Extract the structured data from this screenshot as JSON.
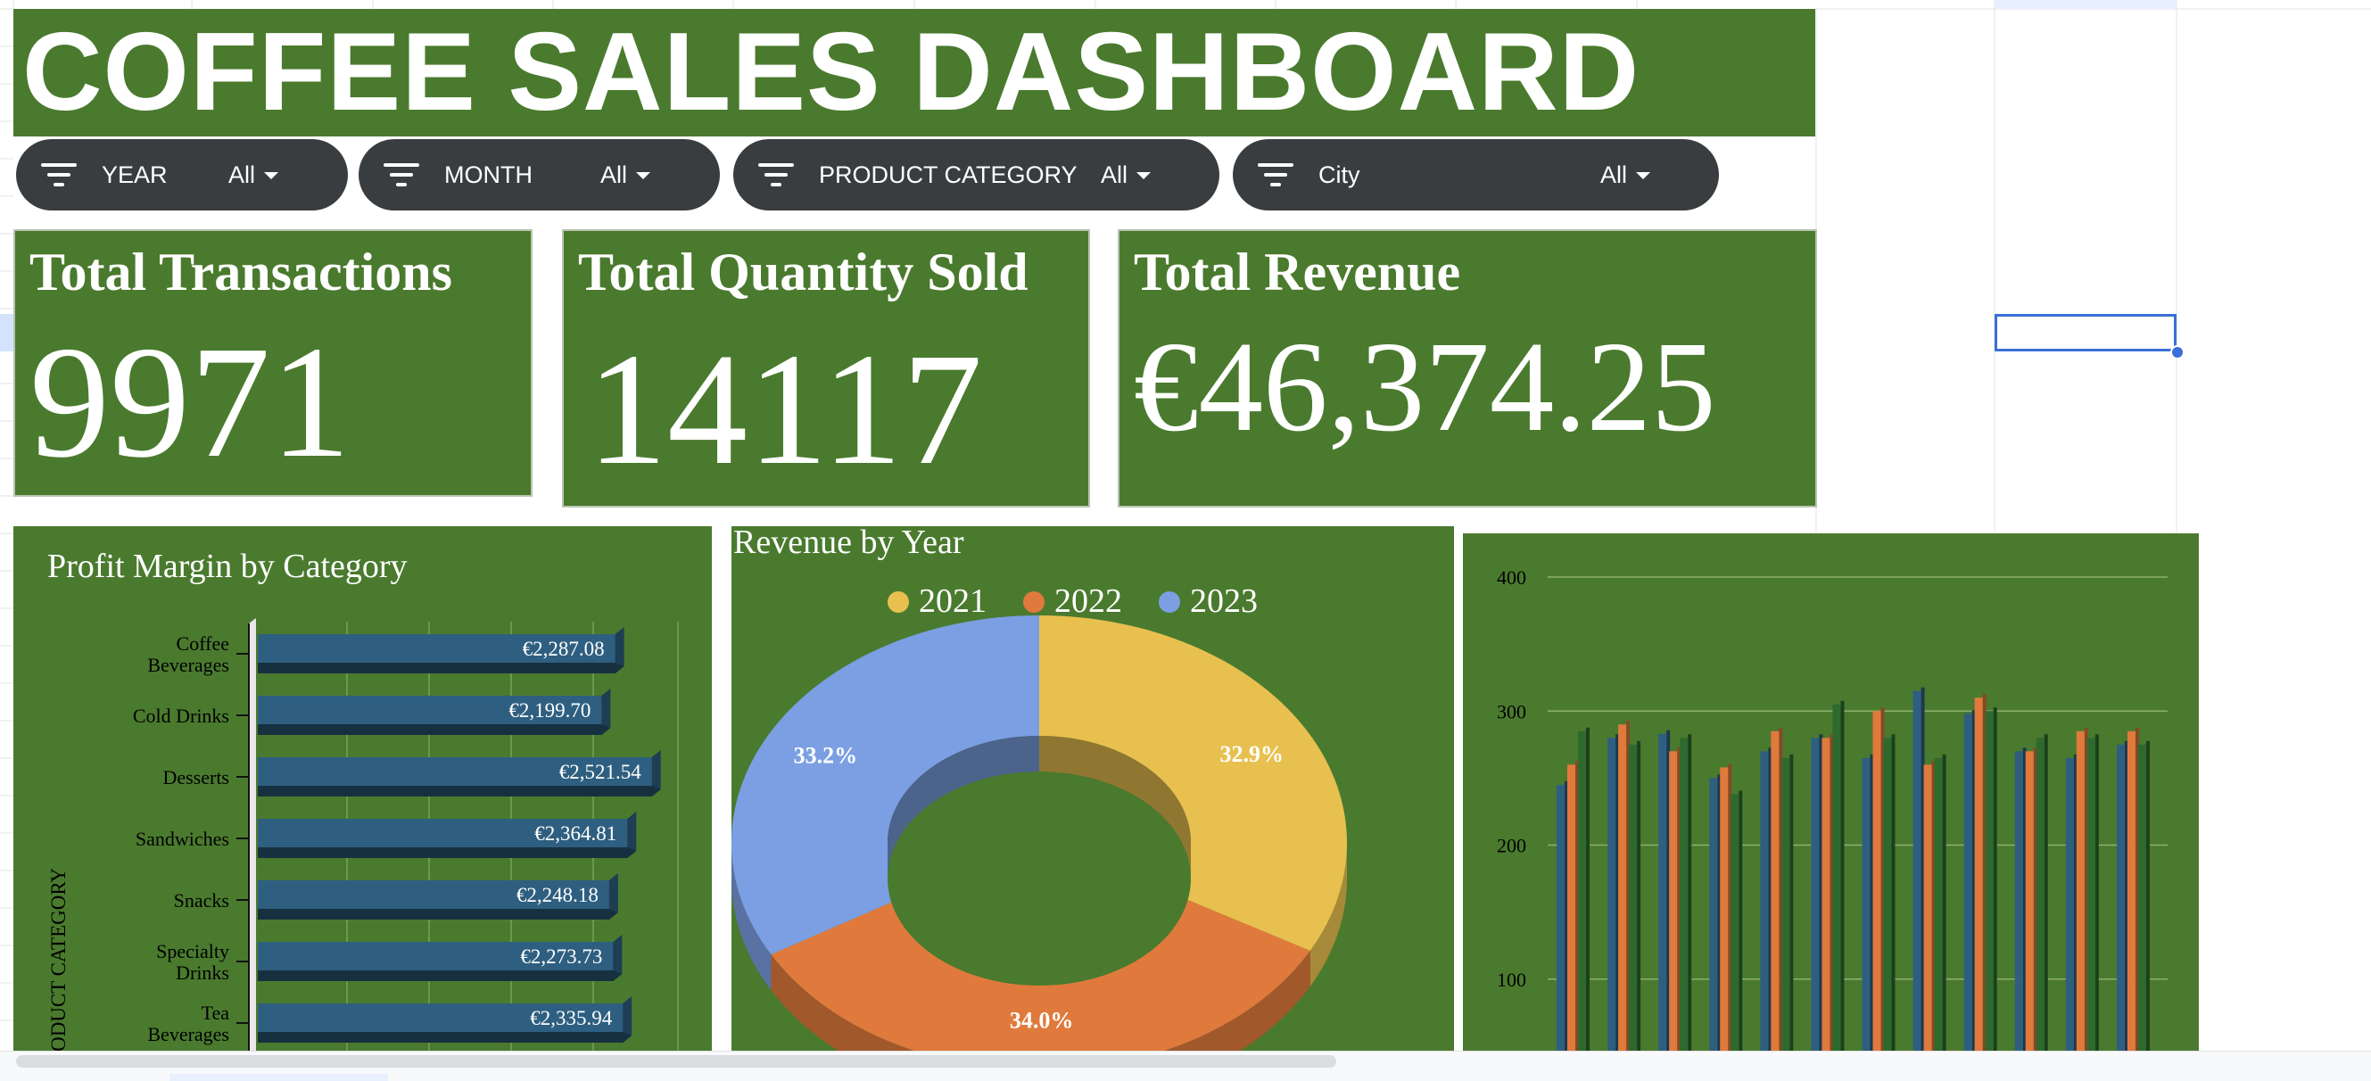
{
  "dashboard": {
    "title": "COFFEE SALES DASHBOARD"
  },
  "filters": [
    {
      "label": "YEAR",
      "value": "All"
    },
    {
      "label": "MONTH",
      "value": "All"
    },
    {
      "label": "PRODUCT CATEGORY",
      "value": "All"
    },
    {
      "label": "City",
      "value": "All"
    }
  ],
  "kpis": {
    "transactions": {
      "label": "Total Transactions",
      "value": "9971"
    },
    "quantity": {
      "label": "Total Quantity Sold",
      "value": "14117"
    },
    "revenue": {
      "label": "Total Revenue",
      "value": "€46,374.25"
    }
  },
  "colors": {
    "panel_green": "#4a7a2e",
    "bar_blue": "#2e5f80",
    "year_2021": "#e8c04f",
    "year_2022": "#e07a3c",
    "year_2023": "#7b9fe2",
    "series_green": "#2e6a2e"
  },
  "icons": [
    "filter-icon",
    "dropdown-caret-icon"
  ],
  "chart_data": [
    {
      "id": "profit-margin",
      "type": "bar",
      "orientation": "horizontal",
      "style": "3d",
      "title": "Profit Margin by Category",
      "ylabel": "PRODUCT CATEGORY",
      "categories": [
        "Coffee\nBeverages",
        "Cold Drinks",
        "Desserts",
        "Sandwiches",
        "Snacks",
        "Specialty\nDrinks",
        "Tea\nBeverages"
      ],
      "values": [
        2287.08,
        2199.7,
        2521.54,
        2364.81,
        2248.18,
        2273.73,
        2335.94
      ],
      "value_labels": [
        "€2,287.08",
        "€2,199.70",
        "€2,521.54",
        "€2,364.81",
        "€2,248.18",
        "€2,273.73",
        "€2,335.94"
      ]
    },
    {
      "id": "revenue-by-year",
      "type": "pie",
      "style": "3d-donut",
      "title": "Revenue by Year",
      "legend": "top",
      "categories": [
        "2021",
        "2022",
        "2023"
      ],
      "values": [
        32.9,
        34.0,
        33.2
      ],
      "value_labels": [
        "32.9%",
        "34.0%",
        "33.2%"
      ]
    },
    {
      "id": "monthly-by-year",
      "type": "bar",
      "title": "",
      "ylim": [
        0,
        400
      ],
      "yticks": [
        "400",
        "300",
        "200",
        "100"
      ],
      "grid": true,
      "series": [
        {
          "values": [
            245,
            280,
            283,
            250,
            270,
            280,
            265,
            315,
            298,
            270,
            265,
            275
          ]
        },
        {
          "values": [
            260,
            290,
            270,
            258,
            285,
            280,
            300,
            260,
            310,
            270,
            285,
            285
          ]
        },
        {
          "values": [
            285,
            275,
            280,
            238,
            265,
            305,
            280,
            265,
            300,
            280,
            280,
            275
          ]
        }
      ]
    }
  ]
}
